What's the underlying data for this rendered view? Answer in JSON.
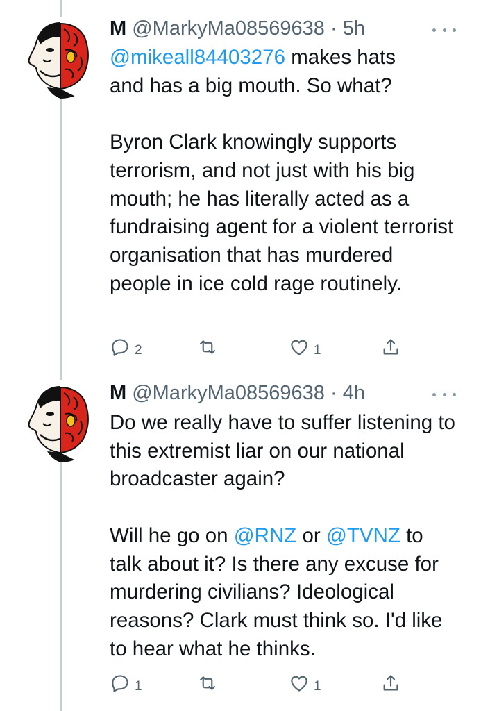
{
  "tweets": [
    {
      "author_name": "M",
      "handle": "@MarkyMa08569638",
      "separator": "·",
      "time": "5h",
      "mention": "@mikeall84403276",
      "text_line1_rest": " makes hats",
      "text_para1_rest": "and has a big mouth. So what?",
      "text_para2": "Byron Clark knowingly supports terrorism, and not just with his big mouth; he has literally acted as a fundraising agent for a violent terrorist organisation that has murdered people in ice cold rage routinely.",
      "replies": "2",
      "retweets": "",
      "likes": "1"
    },
    {
      "author_name": "M",
      "handle": "@MarkyMa08569638",
      "separator": "·",
      "time": "4h",
      "text_para1": "Do we really have to suffer listening to this extremist liar on our national broadcaster again?",
      "para2_start": "Will he go on ",
      "mention_a": "@RNZ",
      "para2_mid": " or ",
      "mention_b": "@TVNZ",
      "para2_end": " to talk about it? Is there any excuse for murdering civilians? Ideological reasons? Clark must think so. I'd like to hear what he thinks.",
      "replies": "1",
      "retweets": "",
      "likes": "1"
    }
  ],
  "icons": [
    "avatar-caricature",
    "more-icon",
    "reply-icon",
    "retweet-icon",
    "like-icon",
    "share-icon"
  ],
  "colors": {
    "text": "#0f1419",
    "secondary": "#536471",
    "link": "#1d9bf0",
    "thread_line": "#c4cfd6"
  }
}
